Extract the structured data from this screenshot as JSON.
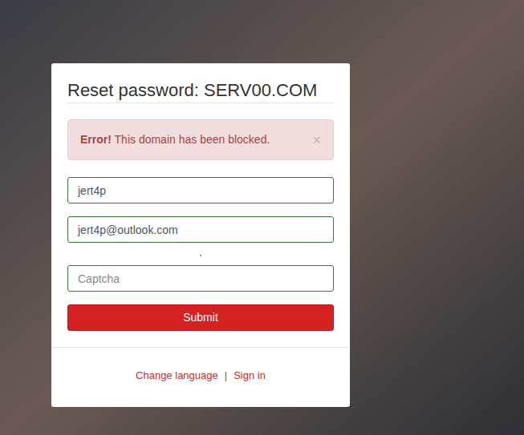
{
  "page": {
    "title": "Reset password: SERV00.COM"
  },
  "alert": {
    "label": "Error!",
    "message": "This domain has been blocked.",
    "close": "×"
  },
  "fields": [
    {
      "value": "jert4p"
    },
    {
      "value": "jert4p@outlook.com"
    },
    {
      "placeholder": "Captcha"
    }
  ],
  "submit": "Submit",
  "links": [
    "Change language",
    "|",
    "Sign in"
  ]
}
